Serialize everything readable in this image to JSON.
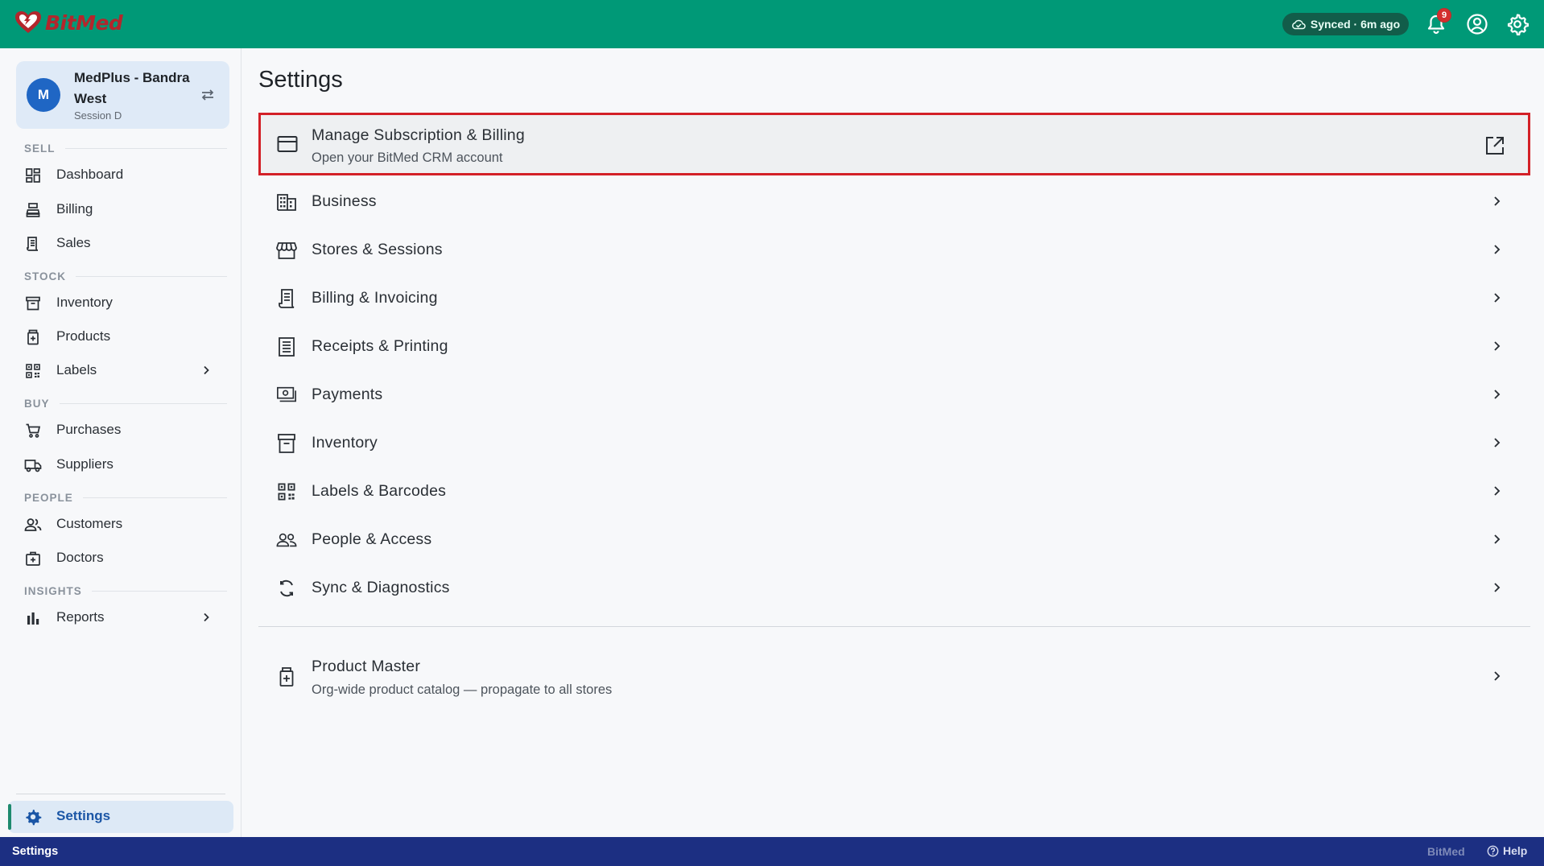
{
  "app": {
    "brand": "BitMed"
  },
  "topbar": {
    "sync_status": "Synced · 6m ago",
    "notification_count": "9",
    "icons": [
      "cloud-check-icon",
      "bell-icon",
      "account-circle-icon",
      "gear-icon"
    ]
  },
  "store": {
    "avatar_letter": "M",
    "name": "MedPlus - Bandra West",
    "session": "Session D"
  },
  "sidebar": {
    "sections": {
      "sell": "SELL",
      "stock": "STOCK",
      "buy": "BUY",
      "people": "PEOPLE",
      "insights": "INSIGHTS"
    },
    "items": {
      "dashboard": "Dashboard",
      "billing": "Billing",
      "sales": "Sales",
      "inventory": "Inventory",
      "products": "Products",
      "labels": "Labels",
      "purchases": "Purchases",
      "suppliers": "Suppliers",
      "customers": "Customers",
      "doctors": "Doctors",
      "reports": "Reports",
      "settings": "Settings"
    }
  },
  "main": {
    "title": "Settings",
    "subscription": {
      "label": "Manage Subscription & Billing",
      "subtitle": "Open your BitMed CRM account"
    },
    "rows": {
      "business": "Business",
      "stores": "Stores & Sessions",
      "billing_invoicing": "Billing & Invoicing",
      "receipts": "Receipts & Printing",
      "payments": "Payments",
      "inventory": "Inventory",
      "labels": "Labels & Barcodes",
      "people": "People & Access",
      "sync": "Sync & Diagnostics"
    },
    "product_master": {
      "label": "Product Master",
      "subtitle": "Org-wide product catalog — propagate to all stores"
    }
  },
  "statusbar": {
    "left": "Settings",
    "brand": "BitMed",
    "help": "Help"
  },
  "colors": {
    "topbar": "#009977",
    "statusbar": "#1c2f82",
    "highlight_border": "#d32027",
    "active_nav_bg": "#dde9f6",
    "active_nav_text": "#1b56a6"
  }
}
